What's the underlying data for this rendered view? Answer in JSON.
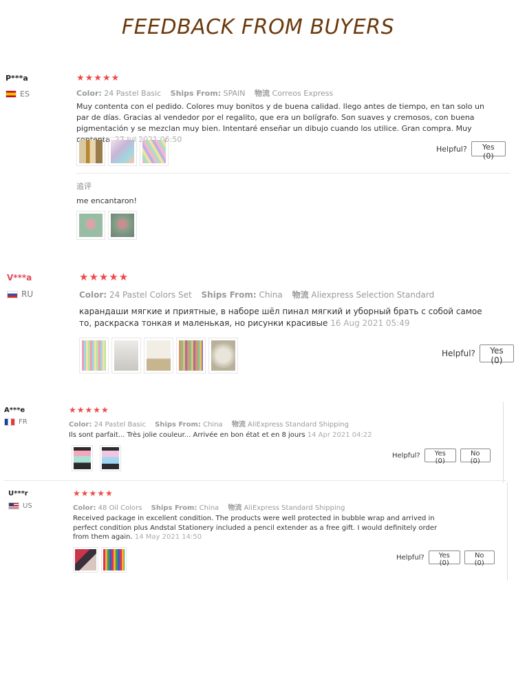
{
  "page_title": "FEEDBACK FROM BUYERS",
  "stars_text": "★★★★★",
  "labels": {
    "color": "Color:",
    "ships_from": "Ships From:",
    "logistics": "物流",
    "helpful": "Helpful?"
  },
  "colors": {
    "title": "#6b3a0e",
    "star": "#f04848"
  },
  "reviews": [
    {
      "user": "P***a",
      "country": "ES",
      "color": "24 Pastel Basic",
      "ships_from": "SPAIN",
      "logistics": "Correos Express",
      "text": "Muy contenta con el pedido. Colores muy bonitos y de buena calidad. llego antes de tiempo, en tan solo un par de días. Gracias al vendedor por el regalito, que era un bolígrafo. Son suaves y cremosos, con buena pigmentación y se mezclan muy bien. Intentaré enseñar un dibujo cuando los utilice. Gran compra. Muy contenta.",
      "date": "27 Jul 2021 06:50",
      "yes": "Yes (0)",
      "followup_label": "追评",
      "followup_text": "me encantaron!"
    },
    {
      "user": "V***a",
      "country": "RU",
      "color": "24 Pastel Colors Set",
      "ships_from": "China",
      "logistics": "Aliexpress Selection Standard",
      "text": "карандаши мягкие и приятные, в наборе шёл пинал мягкий и уборный брать с собой самое то, раскраска тонкая и маленькая, но рисунки красивые",
      "date": "16 Aug 2021 05:49",
      "yes": "Yes (0)"
    },
    {
      "user": "A***e",
      "country": "FR",
      "color": "24 Pastel Basic",
      "ships_from": "China",
      "logistics": "AliExpress Standard Shipping",
      "text": "Ils sont parfait... Très jolie couleur... Arrivée en bon état et en 8 jours",
      "date": "14 Apr 2021 04:22",
      "yes": "Yes (0)",
      "no": "No (0)"
    },
    {
      "user": "U***r",
      "country": "US",
      "color": "48 Oil Colors",
      "ships_from": "China",
      "logistics": "AliExpress Standard Shipping",
      "text": "Received package in excellent condition. The products were well protected in bubble wrap and arrived in perfect condition plus Andstal Stationery included a pencil extender as a free gift. I would definitely order from them again.",
      "date": "14 May 2021 14:50",
      "yes": "Yes (0)",
      "no": "No (0)"
    }
  ]
}
